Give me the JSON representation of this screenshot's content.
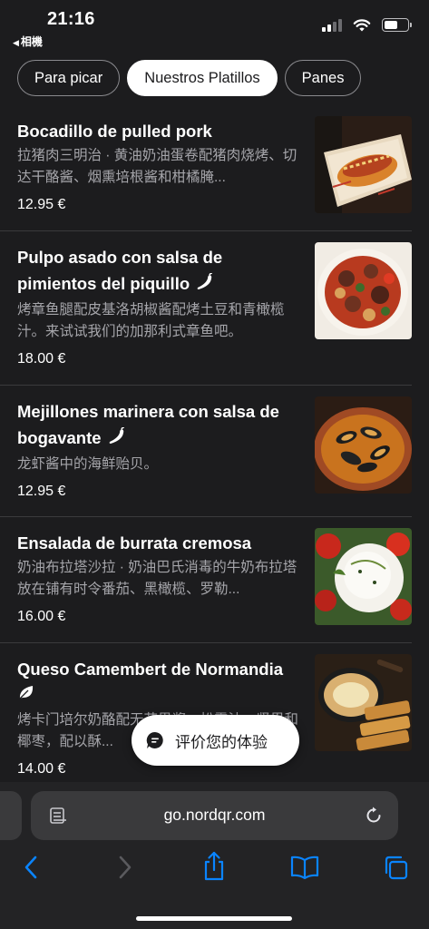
{
  "status": {
    "time": "21:16",
    "back_app": "相機"
  },
  "tabs": [
    {
      "label": "Para picar"
    },
    {
      "label": "Nuestros Platillos"
    },
    {
      "label": "Panes"
    }
  ],
  "items": [
    {
      "name": "Bocadillo de pulled pork",
      "desc": "拉猪肉三明治 · 黄油奶油蛋卷配猪肉烧烤、切达干酪酱、烟熏培根酱和柑橘腌...",
      "price": "12.95 €"
    },
    {
      "name": "Pulpo asado con salsa de pimientos del piquillo",
      "desc": "烤章鱼腿配皮基洛胡椒酱配烤土豆和青橄榄汁。来试试我们的加那利式章鱼吧。",
      "price": "18.00 €",
      "icon": "chili-icon"
    },
    {
      "name": "Mejillones marinera con salsa de bogavante",
      "desc": "龙虾酱中的海鲜贻贝。",
      "price": "12.95 €",
      "icon": "chili-icon"
    },
    {
      "name": "Ensalada de burrata cremosa",
      "desc": "奶油布拉塔沙拉 · 奶油巴氏消毒的牛奶布拉塔放在铺有时令番茄、黑橄榄、罗勒...",
      "price": "16.00 €"
    },
    {
      "name": "Queso Camembert de Normandia",
      "desc": "烤卡门培尔奶酪配无花果酱、松露油、坚果和椰枣，配以酥...",
      "price": "14.00 €",
      "icon": "leaf-icon"
    }
  ],
  "feedback": {
    "label": "评价您的体验"
  },
  "browser": {
    "url": "go.nordqr.com"
  },
  "colors": {
    "background": "#1c1c1e",
    "accent_blue": "#0a84ff",
    "text_secondary": "#a5a5aa"
  }
}
